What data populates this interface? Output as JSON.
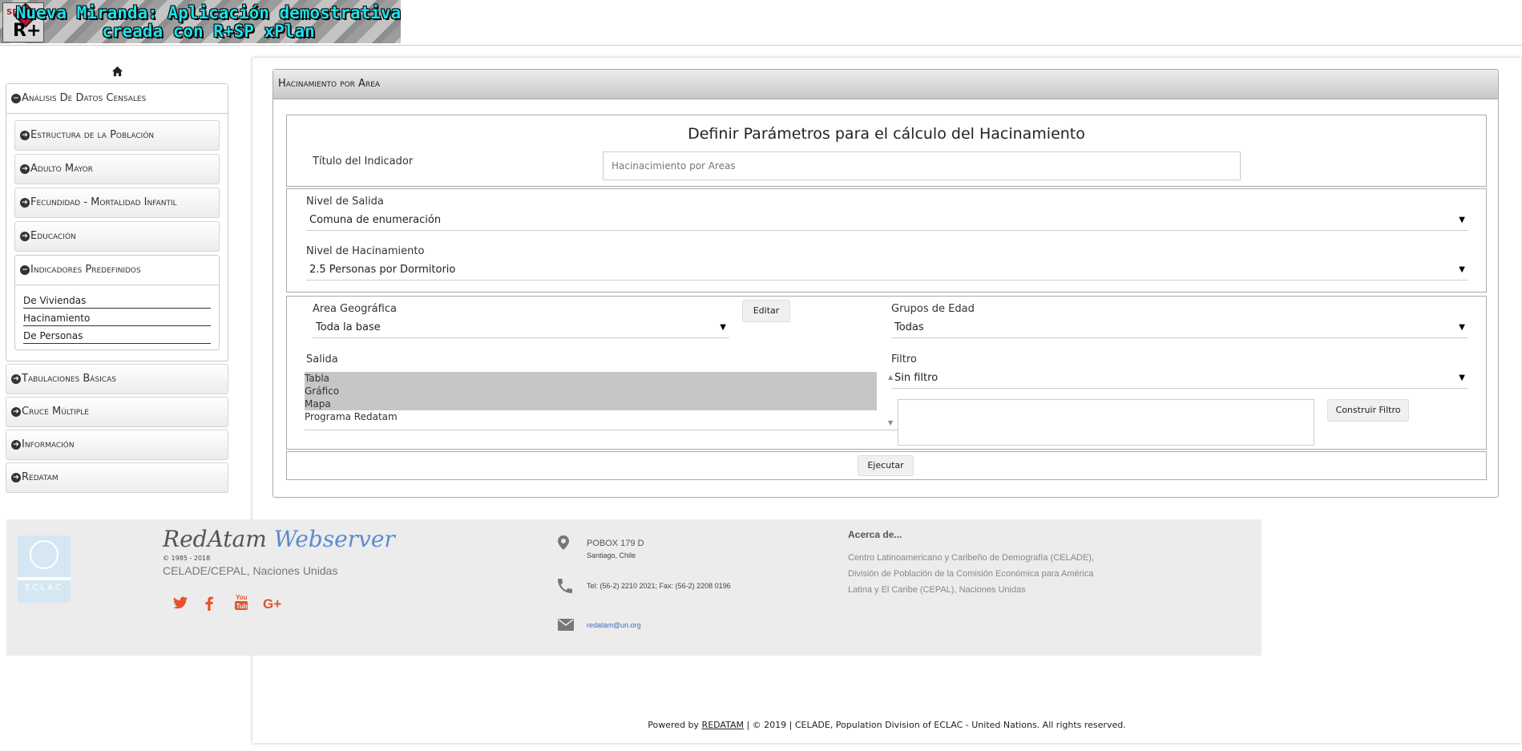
{
  "header": {
    "title_line1": "Nueva Miranda: Aplicación demostrativa",
    "title_line2": "creada con R+SP xPlan",
    "logo_text": "R+",
    "logo_sp": "SP"
  },
  "sidebar": {
    "home_icon": "home-icon",
    "sections": [
      {
        "label": "Análisis De Datos Censales",
        "state": "open"
      },
      {
        "label": "Tabulaciones Básicas"
      },
      {
        "label": "Cruce Múltiple"
      },
      {
        "label": "Información"
      },
      {
        "label": "Redatam"
      }
    ],
    "subsections": [
      {
        "label": "Estructura de la Población"
      },
      {
        "label": "Adulto Mayor"
      },
      {
        "label": "Fecundidad - Mortalidad Infantil"
      },
      {
        "label": "Educación"
      },
      {
        "label": "Indicadores Predefinidos",
        "state": "open"
      }
    ],
    "leaves": [
      "De Viviendas",
      "Hacinamiento",
      "De Personas"
    ]
  },
  "panel": {
    "title": "Hacinamiento por Area",
    "heading": "Definir Parámetros para el cálculo del Hacinamiento",
    "indicador_label": "Título del Indicador",
    "indicador_placeholder": "Hacinacimiento por Areas",
    "nivel_salida_label": "Nivel de Salida",
    "nivel_salida_value": "Comuna de enumeración",
    "nivel_hacinamiento_label": "Nivel de Hacinamiento",
    "nivel_hacinamiento_value": "2.5 Personas por Dormitorio",
    "area_label": "Area Geográfica",
    "area_value": "Toda la base",
    "editar_label": "Editar",
    "grupos_label": "Grupos de Edad",
    "grupos_value": "Todas",
    "salida_label": "Salida",
    "salida_options": [
      {
        "label": "Tabla",
        "selected": true
      },
      {
        "label": "Gráfico",
        "selected": true
      },
      {
        "label": "Mapa",
        "selected": true
      },
      {
        "label": "Programa Redatam",
        "selected": false
      }
    ],
    "filtro_label": "Filtro",
    "filtro_value": "Sin filtro",
    "construir_label": "Construir Filtro",
    "ejecutar_label": "Ejecutar"
  },
  "footer": {
    "logo_text": "ECLAC",
    "brand_part1": "RedAtam",
    "brand_part2": "Webserver",
    "copyright_years": "© 1985 - 2018",
    "org": "CELADE/CEPAL, Naciones Unidas",
    "social": [
      "twitter-icon",
      "facebook-icon",
      "youtube-icon",
      "google-plus-icon"
    ],
    "address_line1": "POBOX 179 D",
    "address_line2": "Santiago, Chile",
    "phone": "Tel: (56-2) 2210 2021; Fax: (56-2) 2208 0196",
    "email": "redatam@un.org",
    "about_title": "Acerca de...",
    "about_text": "Centro Latinoamericano y Caribeño de Demografía (CELADE), División de Población de la Comisión Económica para América Latina y El Caribe (CEPAL), Naciones Unidas",
    "bottom_prefix": "Powered by ",
    "bottom_link": "REDATAM",
    "bottom_suffix": " | © 2019 | CELADE, Population Division of ECLAC - United Nations. All rights reserved.",
    "email_color": "#3d6fc2",
    "social_color": "#e4532b"
  }
}
